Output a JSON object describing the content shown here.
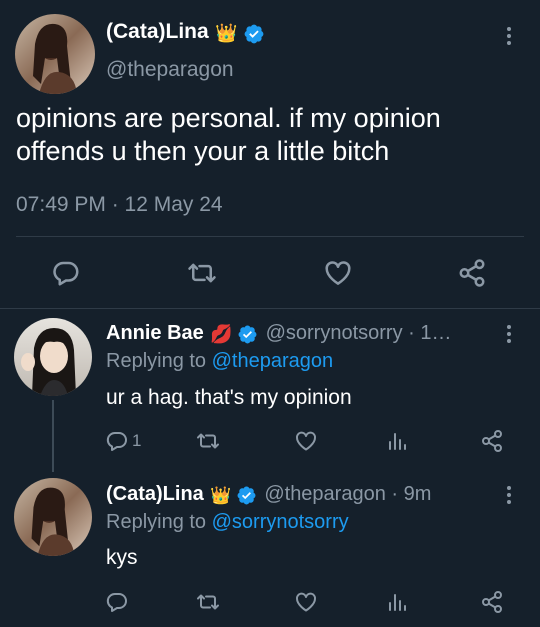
{
  "main_tweet": {
    "author_name": "(Cata)Lina",
    "author_handle": "@theparagon",
    "text": "opinions are personal. if my opinion offends u then your a little bitch",
    "timestamp": "07:49 PM · 12 May 24",
    "name_emoji": "👑"
  },
  "replies": [
    {
      "author_name": "Annie Bae",
      "name_emoji": "💋",
      "meta": "@sorrynotsorry · 1…",
      "replying_label": "Replying to",
      "replying_to": "@theparagon",
      "text": "ur a hag. that's my opinion",
      "reply_count": "1"
    },
    {
      "author_name": "(Cata)Lina",
      "name_emoji": "👑",
      "meta": "@theparagon · 9m",
      "replying_label": "Replying to",
      "replying_to": "@sorrynotsorry",
      "text": "kys",
      "reply_count": ""
    }
  ],
  "icons": {
    "verified": "verified-badge-icon",
    "more": "more-vertical-icon",
    "reply": "reply-icon",
    "retweet": "retweet-icon",
    "like": "heart-icon",
    "views": "views-bars-icon",
    "share": "share-icon"
  },
  "colors": {
    "background": "#15202b",
    "accent": "#1d9bf0",
    "muted": "#8b98a5",
    "divider": "#2f3b47"
  }
}
